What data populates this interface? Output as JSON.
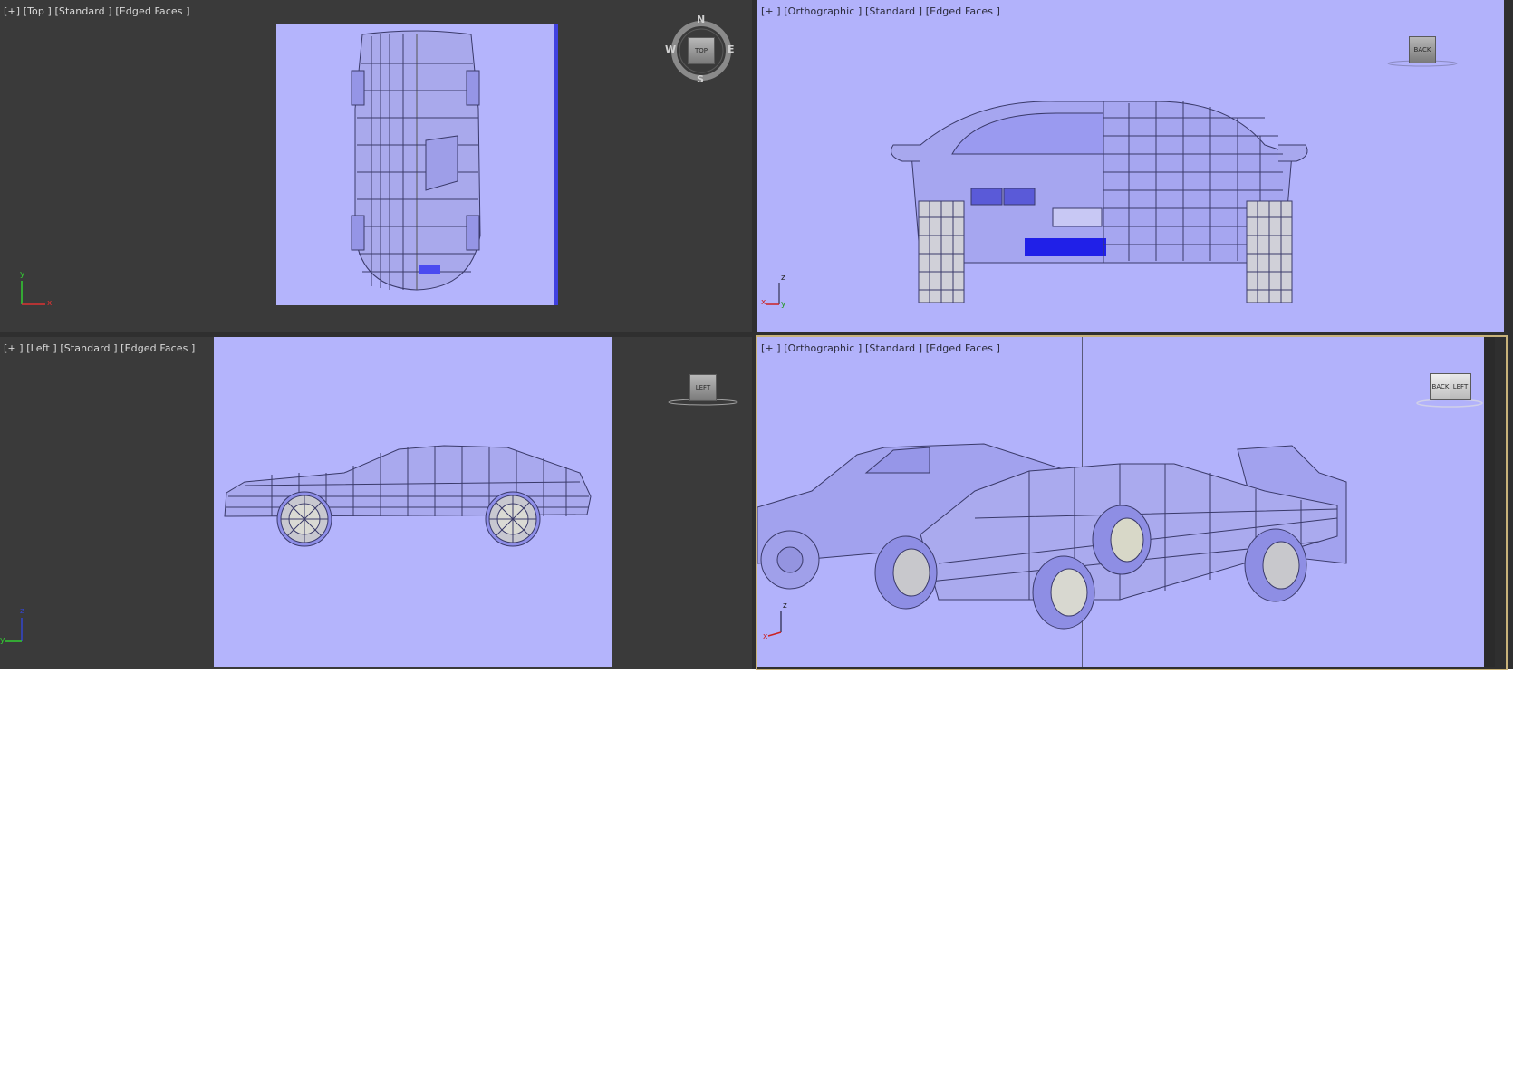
{
  "viewports": {
    "top_left": {
      "label": "[+] [Top ] [Standard ] [Edged Faces ]",
      "cube_label": "TOP",
      "compass": {
        "n": "N",
        "s": "S",
        "e": "E",
        "w": "W"
      },
      "axis": {
        "a": "y",
        "b": "x"
      }
    },
    "top_right": {
      "label": "[+ ] [Orthographic ] [Standard ] [Edged Faces ]",
      "cube_label": "BACK",
      "axis": {
        "a": "z",
        "b": "x",
        "c": "y"
      }
    },
    "bottom_left": {
      "label": "[+ ] [Left ] [Standard ] [Edged Faces ]",
      "cube_label": "LEFT",
      "axis": {
        "a": "z",
        "b": "y"
      }
    },
    "bottom_right": {
      "label": "[+ ] [Orthographic ] [Standard ] [Edged Faces ]",
      "cube_label_a": "BACK",
      "cube_label_b": "LEFT",
      "axis": {
        "a": "z",
        "b": "x"
      }
    }
  },
  "colors": {
    "viewport_bg": "#3a3a3a",
    "reference_plane": "#b4b4fc",
    "wire": "#3a3a6a",
    "active_border": "#c8b27a"
  }
}
